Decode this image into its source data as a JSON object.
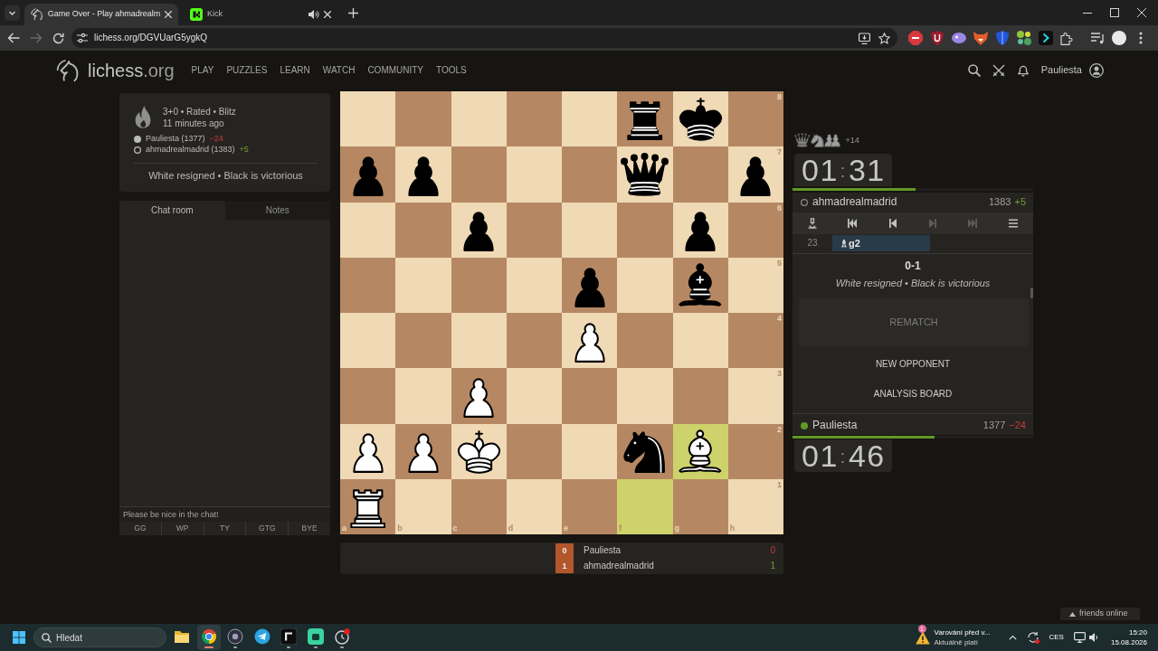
{
  "browser": {
    "tabs": [
      {
        "title": "Game Over - Play ahmadrealm",
        "selected": true,
        "kind": "lichess",
        "audio": false
      },
      {
        "title": "Kick",
        "selected": false,
        "kind": "kick",
        "audio": true
      }
    ],
    "url": "lichess.org/DGVUarG5ygkQ"
  },
  "header": {
    "site": "lichess",
    "domain": ".org",
    "nav": [
      "PLAY",
      "PUZZLES",
      "LEARN",
      "WATCH",
      "COMMUNITY",
      "TOOLS"
    ],
    "user": "Pauliesta"
  },
  "game_info": {
    "setup": "3+0 • Rated • Blitz",
    "time": "11 minutes ago",
    "players": [
      {
        "kind": "white",
        "name": "Pauliesta (1377)",
        "diff": "−24",
        "gain": false
      },
      {
        "kind": "black",
        "name": "ahmadrealmadrid (1383)",
        "diff": "+5",
        "gain": true
      }
    ],
    "status": "White resigned • Black is victorious"
  },
  "chat": {
    "tabs": [
      {
        "label": "Chat room",
        "selected": true
      },
      {
        "label": "Notes",
        "selected": false
      }
    ],
    "placeholder": "Please be nice in the chat!",
    "presets": [
      "GG",
      "WP",
      "TY",
      "GTG",
      "BYE"
    ]
  },
  "board": {
    "ranks": [
      "8",
      "7",
      "6",
      "5",
      "4",
      "3",
      "2",
      "1"
    ],
    "files": [
      "a",
      "b",
      "c",
      "d",
      "e",
      "f",
      "g",
      "h"
    ],
    "rows": [
      [
        {
          "kind": "empty",
          "last_move": false
        },
        {
          "kind": "empty",
          "last_move": false
        },
        {
          "kind": "empty",
          "last_move": false
        },
        {
          "kind": "empty",
          "last_move": false
        },
        {
          "kind": "empty",
          "last_move": false
        },
        {
          "kind": "rook",
          "black": true,
          "last_move": false
        },
        {
          "kind": "king",
          "black": true,
          "last_move": false
        },
        {
          "kind": "empty",
          "last_move": false
        }
      ],
      [
        {
          "kind": "pawn",
          "black": true,
          "last_move": false
        },
        {
          "kind": "pawn",
          "black": true,
          "last_move": false
        },
        {
          "kind": "empty",
          "last_move": false
        },
        {
          "kind": "empty",
          "last_move": false
        },
        {
          "kind": "empty",
          "last_move": false
        },
        {
          "kind": "queen",
          "black": true,
          "last_move": false
        },
        {
          "kind": "empty",
          "last_move": false
        },
        {
          "kind": "pawn",
          "black": true,
          "last_move": false
        }
      ],
      [
        {
          "kind": "empty",
          "last_move": false
        },
        {
          "kind": "empty",
          "last_move": false
        },
        {
          "kind": "pawn",
          "black": true,
          "last_move": false
        },
        {
          "kind": "empty",
          "last_move": false
        },
        {
          "kind": "empty",
          "last_move": false
        },
        {
          "kind": "empty",
          "last_move": false
        },
        {
          "kind": "pawn",
          "black": true,
          "last_move": false
        },
        {
          "kind": "empty",
          "last_move": false
        }
      ],
      [
        {
          "kind": "empty",
          "last_move": false
        },
        {
          "kind": "empty",
          "last_move": false
        },
        {
          "kind": "empty",
          "last_move": false
        },
        {
          "kind": "empty",
          "last_move": false
        },
        {
          "kind": "pawn",
          "black": true,
          "last_move": false
        },
        {
          "kind": "empty",
          "last_move": false
        },
        {
          "kind": "bishop",
          "black": true,
          "last_move": false
        },
        {
          "kind": "empty",
          "last_move": false
        }
      ],
      [
        {
          "kind": "empty",
          "last_move": false
        },
        {
          "kind": "empty",
          "last_move": false
        },
        {
          "kind": "empty",
          "last_move": false
        },
        {
          "kind": "empty",
          "last_move": false
        },
        {
          "kind": "pawn",
          "black": false,
          "last_move": false
        },
        {
          "kind": "empty",
          "last_move": false
        },
        {
          "kind": "empty",
          "last_move": false
        },
        {
          "kind": "empty",
          "last_move": false
        }
      ],
      [
        {
          "kind": "empty",
          "last_move": false
        },
        {
          "kind": "empty",
          "last_move": false
        },
        {
          "kind": "pawn",
          "black": false,
          "last_move": false
        },
        {
          "kind": "empty",
          "last_move": false
        },
        {
          "kind": "empty",
          "last_move": false
        },
        {
          "kind": "empty",
          "last_move": false
        },
        {
          "kind": "empty",
          "last_move": false
        },
        {
          "kind": "empty",
          "last_move": false
        }
      ],
      [
        {
          "kind": "pawn",
          "black": false,
          "last_move": false
        },
        {
          "kind": "pawn",
          "black": false,
          "last_move": false
        },
        {
          "kind": "king",
          "black": false,
          "last_move": false
        },
        {
          "kind": "empty",
          "last_move": false
        },
        {
          "kind": "empty",
          "last_move": false
        },
        {
          "kind": "knight",
          "black": true,
          "last_move": false
        },
        {
          "kind": "bishop",
          "black": false,
          "last_move": true
        },
        {
          "kind": "empty",
          "last_move": false
        }
      ],
      [
        {
          "kind": "rook",
          "black": false,
          "last_move": false
        },
        {
          "kind": "empty",
          "last_move": false
        },
        {
          "kind": "empty",
          "last_move": false
        },
        {
          "kind": "empty",
          "last_move": false
        },
        {
          "kind": "empty",
          "last_move": false
        },
        {
          "kind": "empty",
          "last_move": true
        },
        {
          "kind": "empty",
          "last_move": false
        },
        {
          "kind": "empty",
          "last_move": false
        }
      ]
    ]
  },
  "crosstable": [
    {
      "points": "0",
      "current": true,
      "name": "Pauliesta",
      "total": "0",
      "gain": false
    },
    {
      "points": "1",
      "current": true,
      "name": "ahmadrealmadrid",
      "total": "1",
      "gain": true
    }
  ],
  "opponent": {
    "material": [
      {
        "kind": "queen"
      },
      {
        "kind": "knight"
      },
      {
        "kind": "pawn"
      },
      {
        "kind": "pawn"
      }
    ],
    "advantage": "+14",
    "clock": {
      "minutes": "01",
      "separator": ":",
      "seconds": "31"
    },
    "level": 0.51,
    "online": false,
    "name": "ahmadrealmadrid",
    "rating": "1383",
    "diff": "+5",
    "gain": true
  },
  "controls": [
    {
      "kind": "analysis",
      "disabled": false
    },
    {
      "kind": "first",
      "disabled": false
    },
    {
      "kind": "prev",
      "disabled": false
    },
    {
      "kind": "next",
      "disabled": true
    },
    {
      "kind": "last",
      "disabled": true
    },
    {
      "kind": "menu",
      "disabled": false
    }
  ],
  "moves": [
    {
      "number": "23",
      "move": "♗g2",
      "selected": true
    }
  ],
  "result": {
    "score": "0-1",
    "text": "White resigned • Black is victorious"
  },
  "actions": [
    {
      "label": "REMATCH",
      "kind": "large",
      "disabled": true
    },
    {
      "label": "NEW OPPONENT",
      "kind": "plain",
      "disabled": false
    },
    {
      "label": "ANALYSIS BOARD",
      "kind": "plain",
      "disabled": false
    }
  ],
  "player": {
    "online": true,
    "name": "Pauliesta",
    "rating": "1377",
    "diff": "−24",
    "gain": false,
    "level": 0.59,
    "clock": {
      "minutes": "01",
      "separator": ":",
      "seconds": "46"
    }
  },
  "friends": {
    "label": "friends online"
  },
  "taskbar": {
    "search": {
      "placeholder": "Hledat"
    },
    "apps": [
      {
        "kind": "explorer",
        "active": false,
        "running": false
      },
      {
        "kind": "chrome",
        "active": true,
        "running": true
      },
      {
        "kind": "lens",
        "active": false,
        "running": true
      },
      {
        "kind": "telegram",
        "active": false,
        "running": false
      },
      {
        "kind": "dark",
        "active": false,
        "running": true
      },
      {
        "kind": "green",
        "active": false,
        "running": true
      },
      {
        "kind": "timer",
        "active": false,
        "running": true
      }
    ],
    "alert": {
      "count": "1",
      "title": "Varování před v...",
      "subtitle": "Aktuálně platí"
    },
    "language": "CES",
    "time": "15:20",
    "date": "15.08.2026"
  }
}
